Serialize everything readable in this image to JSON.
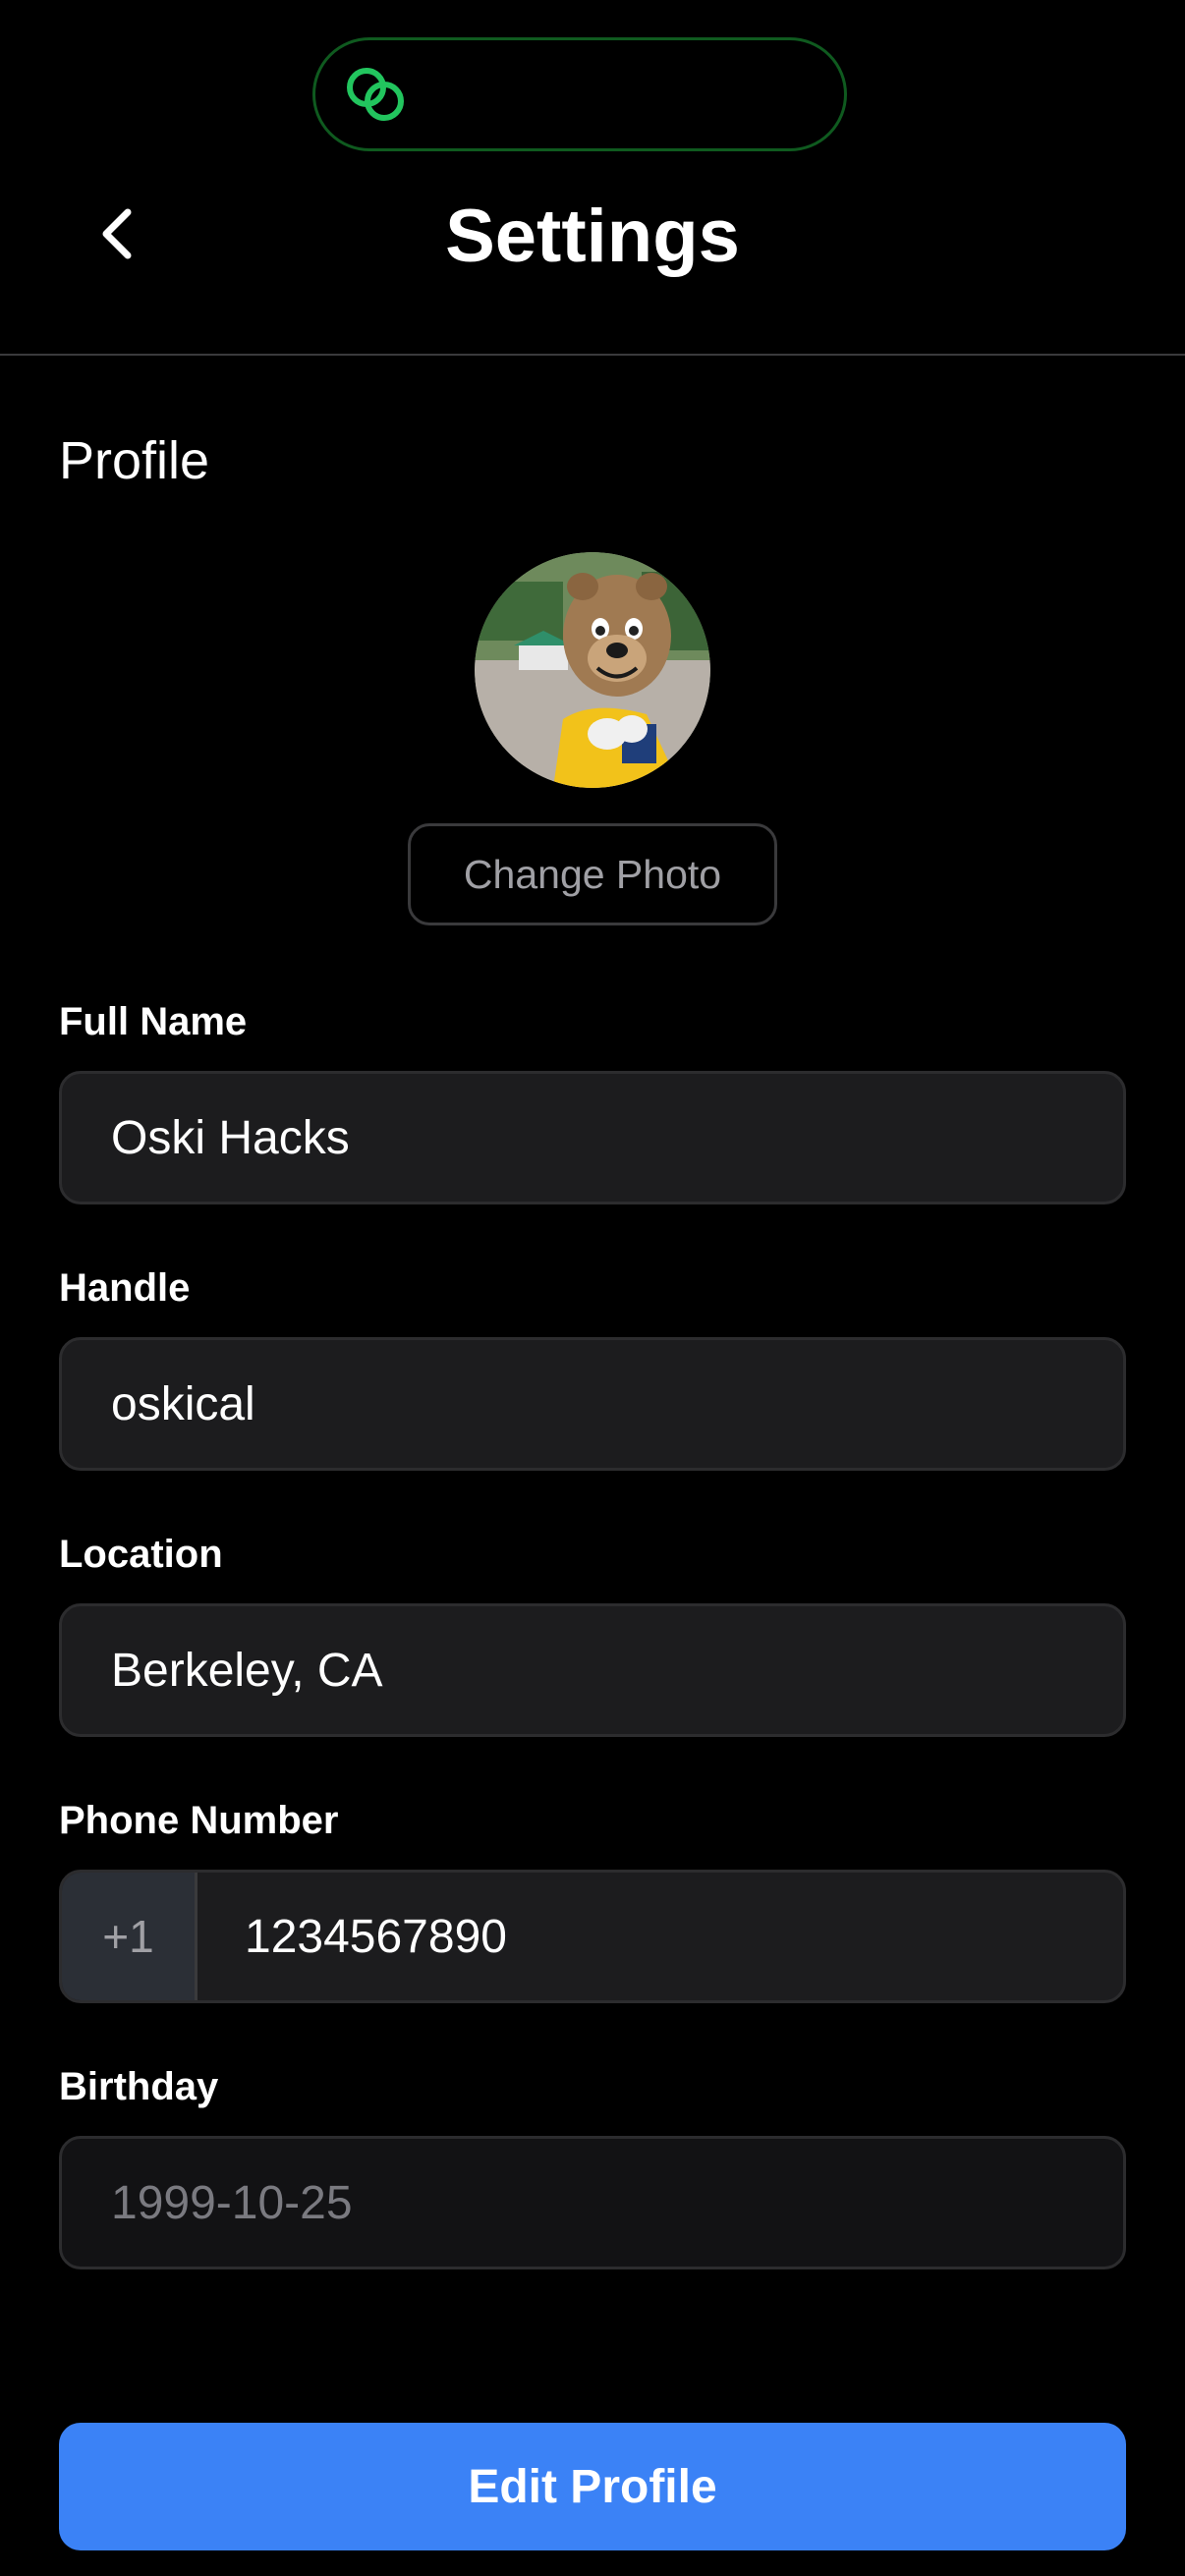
{
  "header": {
    "title": "Settings"
  },
  "profile": {
    "section_title": "Profile",
    "change_photo_label": "Change Photo"
  },
  "fields": {
    "full_name": {
      "label": "Full Name",
      "value": "Oski Hacks"
    },
    "handle": {
      "label": "Handle",
      "value": "oskical"
    },
    "location": {
      "label": "Location",
      "value": "Berkeley, CA"
    },
    "phone": {
      "label": "Phone Number",
      "prefix": "+1",
      "value": "1234567890"
    },
    "birthday": {
      "label": "Birthday",
      "value": "1999-10-25"
    }
  },
  "actions": {
    "edit_profile_label": "Edit Profile"
  },
  "icons": {
    "status_island": "link-icon",
    "back": "chevron-left-icon",
    "avatar": "avatar-photo"
  },
  "colors": {
    "background": "#000000",
    "accent_green": "#22c55e",
    "primary_button": "#3b82f6",
    "field_background": "#1c1c1e"
  }
}
